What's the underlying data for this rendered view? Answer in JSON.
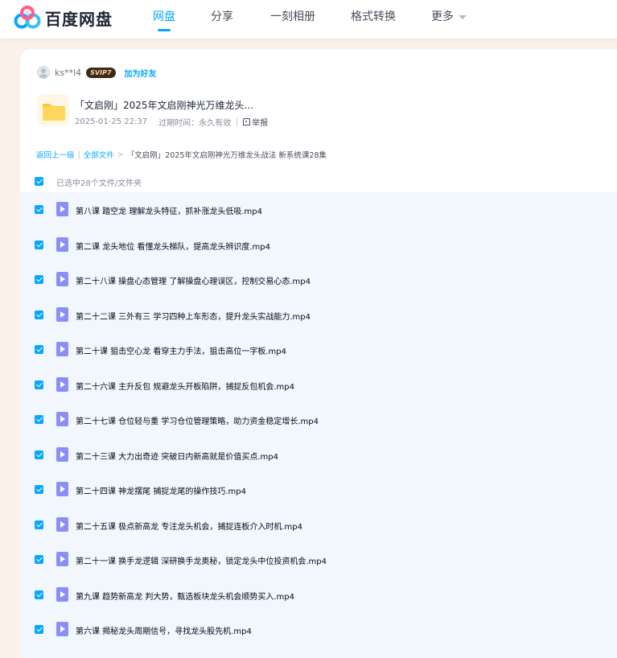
{
  "brand": {
    "name": "百度网盘"
  },
  "nav": {
    "items": [
      {
        "label": "网盘",
        "active": true
      },
      {
        "label": "分享",
        "active": false
      },
      {
        "label": "一刻相册",
        "active": false
      },
      {
        "label": "格式转换",
        "active": false
      },
      {
        "label": "更多",
        "active": false
      }
    ]
  },
  "share": {
    "username": "ks**l4",
    "badge": "SVIP7",
    "add_friend": "加为好友",
    "title": "「文启刚」2025年文启刚神光万维龙头...",
    "date": "2025-01-25 22:37",
    "expiry_label": "过期时间：",
    "expiry_value": "永久有效",
    "report": "举报"
  },
  "breadcrumb": {
    "back": "返回上一级",
    "all": "全部文件",
    "current": "「文启刚」2025年文启刚神光万维龙头战法 新系统课28集"
  },
  "selection": {
    "text": "已选中28个文件/文件夹"
  },
  "files": [
    "第八课 踏空龙 理解龙头特征，抓补涨龙头低吸.mp4",
    "第二课 龙头地位 看懂龙头梯队，提高龙头辨识度.mp4",
    "第二十八课 操盘心态管理 了解操盘心理误区，控制交易心态.mp4",
    "第二十二课 三外有三 学习四种上车形态，提升龙头实战能力.mp4",
    "第二十课 狙击空心龙 看穿主力手法，狙击高位一字板.mp4",
    "第二十六课 主升反包 规避龙头开板陷阱，捕捉反包机会.mp4",
    "第二十七课 仓位轻与重 学习仓位管理策略，助力资金稳定增长.mp4",
    "第二十三课 大力出奇迹 突破日内新高就是价值买点.mp4",
    "第二十四课 神龙摆尾 捕捉龙尾的操作技巧.mp4",
    "第二十五课 极点新高龙 专注龙头机会，捕捉连板介入时机.mp4",
    "第二十一课 换手龙逻辑 深研换手龙奥秘，锁定龙头中位投资机会.mp4",
    "第九课 趋势新高龙 判大势，甄选板块龙头机会顺势买入.mp4",
    "第六课 揭秘龙头周期信号，寻找龙头股先机.mp4"
  ],
  "colors": {
    "accent": "#06a7ff",
    "list_bg": "#f2f7fd",
    "page_bg": "#fcf0ea",
    "video_icon": "#8b8ff5",
    "folder": "#ffc93c"
  }
}
